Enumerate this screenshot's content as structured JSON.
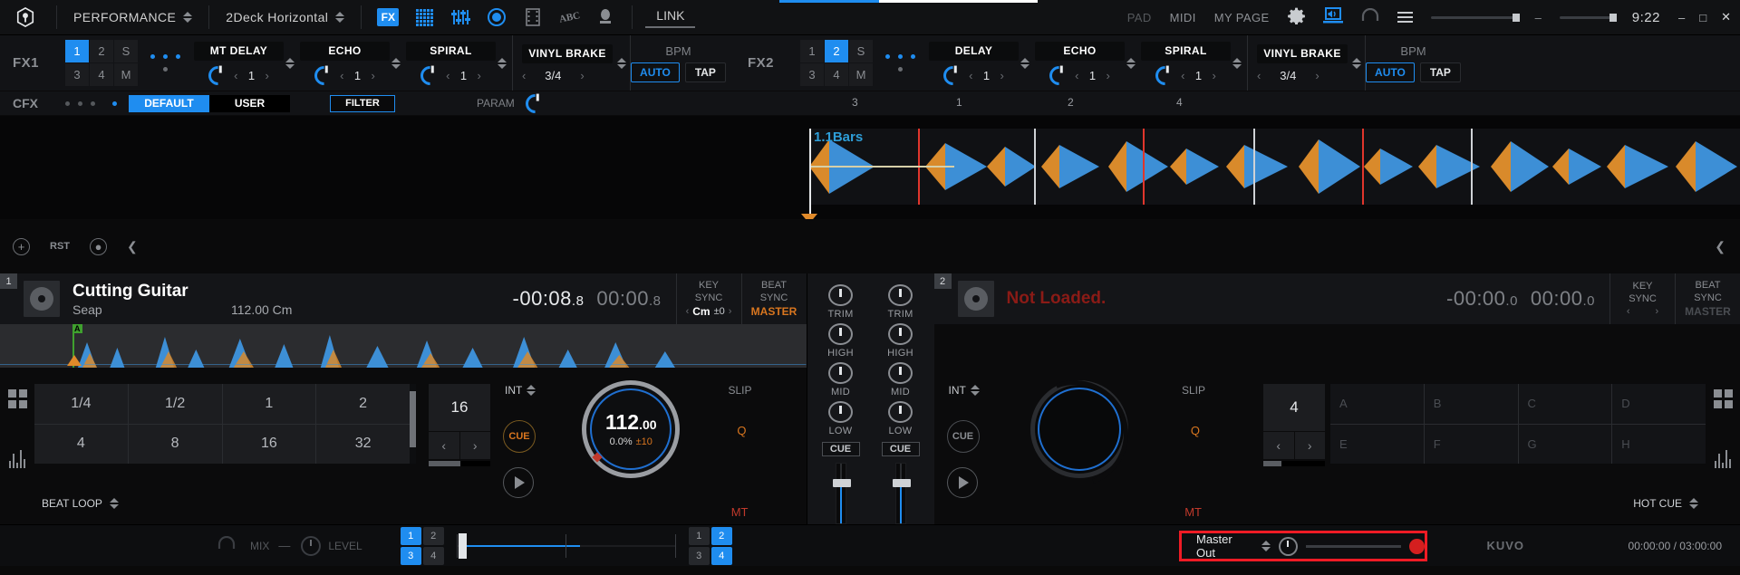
{
  "topbar": {
    "logo_icon": "rekordbox-logo-icon",
    "mode": "PERFORMANCE",
    "layout": "2Deck Horizontal",
    "icons": [
      "fx-icon",
      "pad-grid-icon",
      "sampler-icon",
      "record-icon",
      "video-icon",
      "lyric-icon",
      "mic-icon"
    ],
    "link_label": "LINK",
    "menu": [
      "PAD",
      "MIDI",
      "MY PAGE"
    ],
    "gear_icon": "gear-icon",
    "monitor_icon": "monitor-icon",
    "headphone_icon": "headphone-icon",
    "hamburger_icon": "hamburger-icon",
    "clock": "9:22",
    "window_minimize": "–",
    "window_maximize": "□",
    "window_close": "✕"
  },
  "fx1": {
    "label": "FX1",
    "channels": [
      "1",
      "2",
      "S",
      "3",
      "4",
      "M"
    ],
    "active_channel": "1",
    "slots": [
      {
        "name": "MT DELAY",
        "value": "1"
      },
      {
        "name": "ECHO",
        "value": "1"
      },
      {
        "name": "SPIRAL",
        "value": "1"
      }
    ],
    "release": {
      "name": "VINYL BRAKE",
      "value": "3/4"
    },
    "bpm": {
      "label": "BPM",
      "auto": "AUTO",
      "tap": "TAP"
    }
  },
  "fx2": {
    "label": "FX2",
    "channels": [
      "1",
      "2",
      "S",
      "3",
      "4",
      "M"
    ],
    "active_channel": "2",
    "slots": [
      {
        "name": "DELAY",
        "value": "1"
      },
      {
        "name": "ECHO",
        "value": "1"
      },
      {
        "name": "SPIRAL",
        "value": "1"
      }
    ],
    "release": {
      "name": "VINYL BRAKE",
      "value": "3/4"
    },
    "bpm": {
      "label": "BPM",
      "auto": "AUTO",
      "tap": "TAP"
    }
  },
  "cfx": {
    "label": "CFX",
    "default_label": "DEFAULT",
    "user_label": "USER",
    "active_bank": "DEFAULT",
    "filter_label": "FILTER",
    "param_label": "PARAM"
  },
  "waveform": {
    "phrase_label": "1.1Bars",
    "beat_numbers": [
      "3",
      "1",
      "2",
      "4"
    ]
  },
  "ministrip": {
    "add_icon": "add-circle-icon",
    "rst_label": "RST",
    "comment_icon": "comment-icon",
    "collapse_left_icon": "chevron-left-icon",
    "collapse_right_icon": "chevron-left-icon"
  },
  "deck1": {
    "number": "1",
    "title": "Cutting Guitar",
    "artist": "Seap",
    "bpm_key": "112.00 Cm",
    "remain_time": "-00:08",
    "remain_frac": ".8",
    "elapsed_time": "00:00",
    "elapsed_frac": ".8",
    "key_sync_label_1": "KEY",
    "key_sync_label_2": "SYNC",
    "key_value": "Cm",
    "key_shift": "±0",
    "beat_sync_label_1": "BEAT",
    "beat_sync_label_2": "SYNC",
    "sync_state": "MASTER",
    "hotcue_marker": "A",
    "beat_loop": {
      "values": [
        "1/4",
        "1/2",
        "1",
        "2",
        "4",
        "8",
        "16",
        "32"
      ],
      "footer_label": "BEAT LOOP",
      "loop_length": "16"
    },
    "int_label": "INT",
    "slip_label": "SLIP",
    "q_label": "Q",
    "mt_label": "MT",
    "cue_label": "CUE",
    "jog_bpm_int": "112",
    "jog_bpm_dec": ".00",
    "tempo_pct": "0.0%",
    "tempo_range": "±10"
  },
  "deck2": {
    "number": "2",
    "title": "Not Loaded.",
    "remain_time": "-00:00",
    "remain_frac": ".0",
    "elapsed_time": "00:00",
    "elapsed_frac": ".0",
    "key_sync_label_1": "KEY",
    "key_sync_label_2": "SYNC",
    "beat_sync_label_1": "BEAT",
    "beat_sync_label_2": "SYNC",
    "sync_state": "MASTER",
    "hotcue_pads": [
      "A",
      "B",
      "C",
      "D",
      "E",
      "F",
      "G",
      "H"
    ],
    "hotcue_footer": "HOT CUE",
    "loop_length": "4",
    "int_label": "INT",
    "slip_label": "SLIP",
    "q_label": "Q",
    "mt_label": "MT",
    "cue_label": "CUE"
  },
  "mixer": {
    "channels": [
      {
        "trim": "TRIM",
        "high": "HIGH",
        "mid": "MID",
        "low": "LOW",
        "cue": "CUE"
      },
      {
        "trim": "TRIM",
        "high": "HIGH",
        "mid": "MID",
        "low": "LOW",
        "cue": "CUE"
      }
    ]
  },
  "bottombar": {
    "headphone_icon": "headphone-icon",
    "mix_label": "MIX",
    "level_label": "LEVEL",
    "xfader_left_channels": [
      "1",
      "2",
      "3",
      "4"
    ],
    "xfader_left_active": [
      "1",
      "3"
    ],
    "xfader_right_channels": [
      "1",
      "2",
      "3",
      "4"
    ],
    "xfader_right_active": [
      "2",
      "4"
    ],
    "master_out_label": "Master Out",
    "record_icon": "record-icon",
    "kuvo_label": "KUVO",
    "rec_elapsed": "00:00:00",
    "rec_total": "03:00:00",
    "rec_sep": "/"
  },
  "colors": {
    "accent_blue": "#1f8df0",
    "orange": "#d9761f",
    "red_highlight": "#ef1b25",
    "error_red": "#8b1b16",
    "green": "#3fa02e"
  }
}
